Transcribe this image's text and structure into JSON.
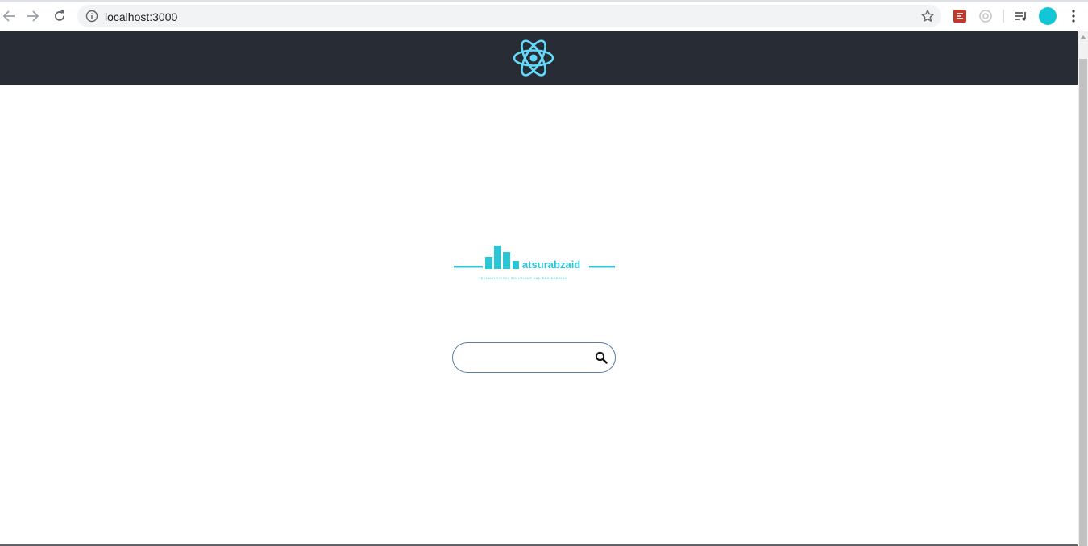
{
  "browser": {
    "url": "localhost:3000",
    "icons": {
      "back": "arrow-back-icon",
      "forward": "arrow-forward-icon",
      "reload": "reload-icon",
      "info": "info-icon",
      "bookmark": "star-icon",
      "menu": "more-vert-icon",
      "media": "media-control-icon"
    },
    "avatar_color": "#11c6d6"
  },
  "header": {
    "background": "#282c34",
    "logo_icon": "react-logo-icon",
    "logo_color": "#61dafb"
  },
  "brand": {
    "name": "atsurabzaid",
    "tagline": "TECHNOLOGICAL SOLUTIONS AND ENGINEERING",
    "color": "#2bc6d6"
  },
  "search": {
    "value": "",
    "placeholder": "",
    "button_icon": "search-icon"
  }
}
